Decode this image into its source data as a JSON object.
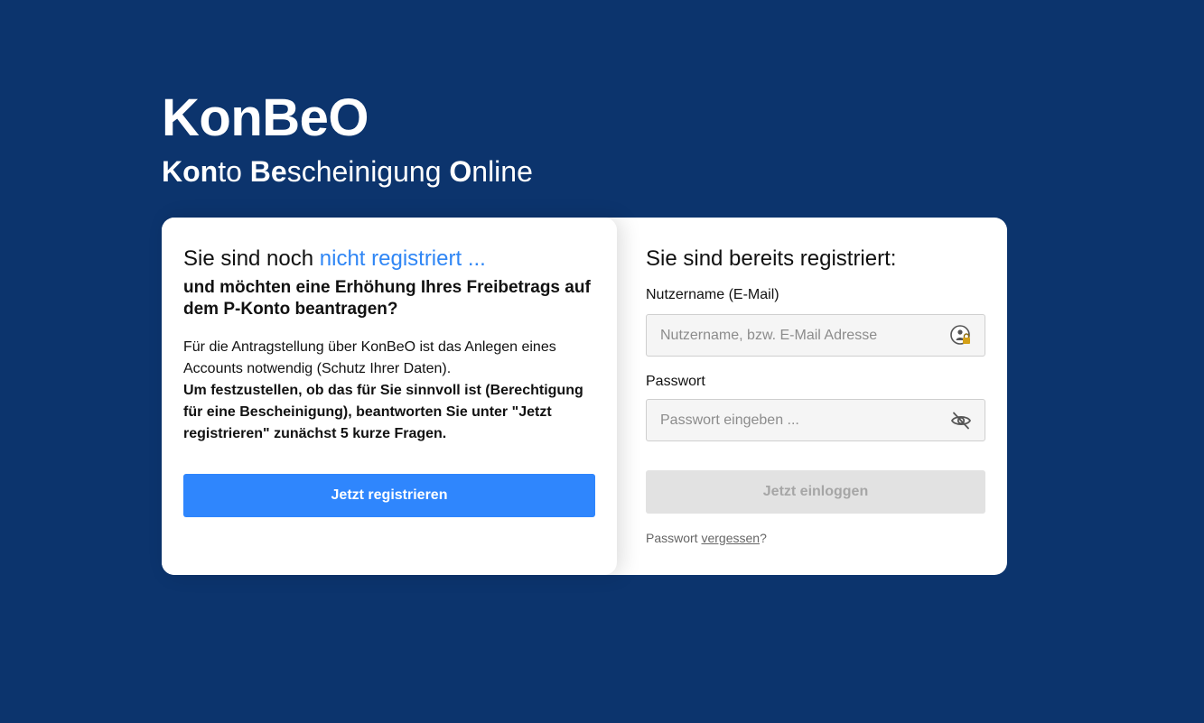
{
  "brand": {
    "title": "KonBeO",
    "subtitle_parts": [
      {
        "bold": "Kon",
        "rest": "to "
      },
      {
        "bold": "Be",
        "rest": "scheinigung "
      },
      {
        "bold": "O",
        "rest": "nline"
      }
    ]
  },
  "register": {
    "heading_prefix": "Sie sind noch ",
    "heading_accent": "nicht registriert ...",
    "subheading": "und möchten eine Erhöhung Ihres Freibetrags auf dem P-Konto beantragen?",
    "body": "Für die Antragstellung über KonBeO ist das Anlegen eines Accounts notwendig (Schutz Ihrer Daten).",
    "body_bold": "Um festzustellen, ob das für Sie sinnvoll ist (Berechtigung für eine Bescheinigung), beantworten Sie unter \"Jetzt registrieren\" zunächst 5 kurze Fragen.",
    "button_label": "Jetzt registrieren"
  },
  "login": {
    "heading": "Sie sind bereits registriert:",
    "username_label": "Nutzername (E-Mail)",
    "username_placeholder": "Nutzername, bzw. E-Mail Adresse",
    "username_icon": "password-manager-icon",
    "password_label": "Passwort",
    "password_placeholder": "Passwort eingeben ...",
    "password_icon": "eye-slash-icon",
    "button_label": "Jetzt einloggen",
    "forgot_prefix": "Passwort ",
    "forgot_link": "vergessen",
    "forgot_suffix": "?"
  },
  "colors": {
    "background": "#0c346d",
    "accent": "#2f86f5",
    "primary_button": "#2f86fd",
    "disabled_button": "#e2e2e2"
  }
}
